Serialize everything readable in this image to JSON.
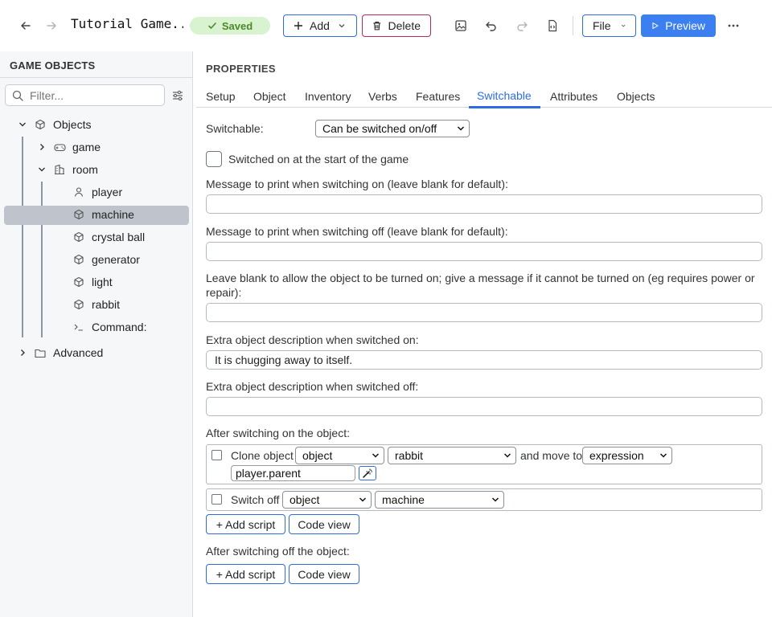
{
  "header": {
    "title": "Tutorial Game...",
    "saved_label": "Saved",
    "add_label": "Add",
    "delete_label": "Delete",
    "file_label": "File",
    "preview_label": "Preview"
  },
  "sidebar": {
    "title": "GAME OBJECTS",
    "filter_placeholder": "Filter...",
    "tree": {
      "objects": "Objects",
      "game": "game",
      "room": "room",
      "player": "player",
      "machine": "machine",
      "crystal_ball": "crystal ball",
      "generator": "generator",
      "light": "light",
      "rabbit": "rabbit",
      "command": "Command:",
      "advanced": "Advanced"
    }
  },
  "main": {
    "title": "PROPERTIES",
    "tabs": [
      "Setup",
      "Object",
      "Inventory",
      "Verbs",
      "Features",
      "Switchable",
      "Attributes",
      "Objects"
    ],
    "active_tab": "Switchable",
    "switchable_label": "Switchable:",
    "switchable_value": "Can be switched on/off",
    "switched_on_start_label": "Switched on at the start of the game",
    "msg_on_label": "Message to print when switching on (leave blank for default):",
    "msg_on_value": "",
    "msg_off_label": "Message to print when switching off (leave blank for default):",
    "msg_off_value": "",
    "cannot_on_label_1": "Leave blank to allow the object to be turned on; give a message if it cannot be turned on (eg requires power or",
    "cannot_on_label_2": "repair):",
    "cannot_on_value": "",
    "desc_on_label": "Extra object description when switched on:",
    "desc_on_value": "It is chugging away to itself.",
    "desc_off_label": "Extra object description when switched off:",
    "desc_off_value": "",
    "after_on_label": "After switching on the object:",
    "script1": {
      "action": "Clone object",
      "type": "object",
      "target": "rabbit",
      "move_label": "and move to",
      "dest_type": "expression",
      "expression": "player.parent"
    },
    "script2": {
      "action": "Switch off",
      "type": "object",
      "target": "machine"
    },
    "add_script_label": "+ Add script",
    "code_view_label": "Code view",
    "after_off_label": "After switching off the object:"
  }
}
